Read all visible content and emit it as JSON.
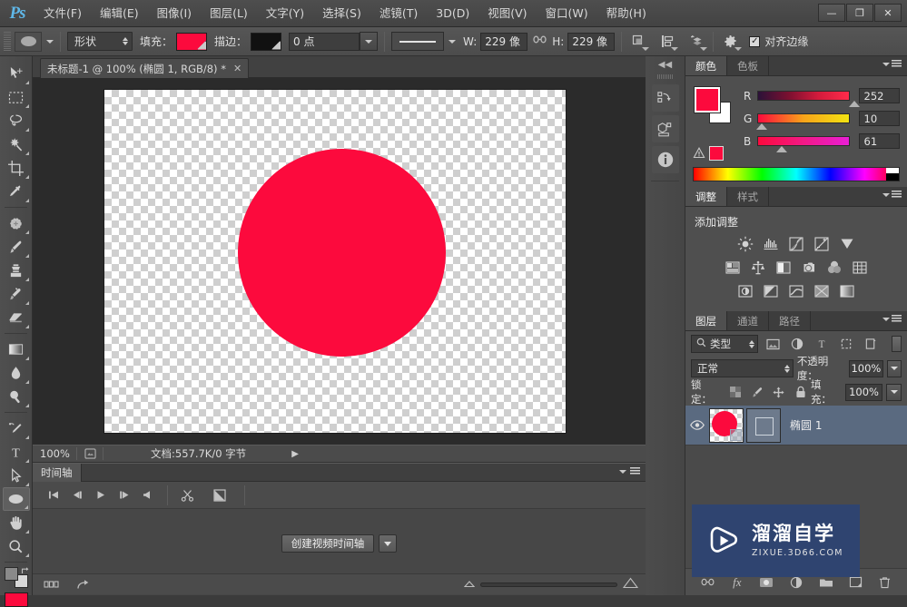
{
  "app": {
    "name": "Photoshop",
    "logo": "Ps"
  },
  "window_controls": {
    "minimize": "—",
    "maximize": "❐",
    "close": "✕"
  },
  "menubar": {
    "items": [
      {
        "label": "文件(F)"
      },
      {
        "label": "编辑(E)"
      },
      {
        "label": "图像(I)"
      },
      {
        "label": "图层(L)"
      },
      {
        "label": "文字(Y)"
      },
      {
        "label": "选择(S)"
      },
      {
        "label": "滤镜(T)"
      },
      {
        "label": "3D(D)"
      },
      {
        "label": "视图(V)"
      },
      {
        "label": "窗口(W)"
      },
      {
        "label": "帮助(H)"
      }
    ]
  },
  "options_bar": {
    "tool_icon": "ellipse-tool-icon",
    "mode_value": "形状",
    "fill_label": "填充：",
    "fill_color": "#FC0A3D",
    "stroke_label": "描边：",
    "stroke_color": "#111111",
    "stroke_width": "0 点",
    "stroke_style": "solid-line",
    "width_label": "W:",
    "width_value": "229 像",
    "link_icon": "link-icon",
    "height_label": "H:",
    "height_value": "229 像",
    "path_op_icon": "path-operations-icon",
    "path_align_icon": "path-alignment-icon",
    "path_arrange_icon": "path-arrangement-icon",
    "gear_icon": "gear-icon",
    "align_edges_checked": "✓",
    "align_edges_label": "对齐边缘"
  },
  "toolbar": {
    "tools": [
      {
        "name": "move-tool",
        "icon": "arrow-move"
      },
      {
        "name": "marquee-tool",
        "icon": "rect-marquee"
      },
      {
        "name": "lasso-tool",
        "icon": "lasso"
      },
      {
        "name": "magic-wand-tool",
        "icon": "magic-wand"
      },
      {
        "name": "crop-tool",
        "icon": "crop"
      },
      {
        "name": "eyedropper-tool",
        "icon": "eyedropper"
      },
      {
        "name": "healing-brush-tool",
        "icon": "healing"
      },
      {
        "name": "brush-tool",
        "icon": "brush"
      },
      {
        "name": "clone-stamp-tool",
        "icon": "stamp"
      },
      {
        "name": "history-brush-tool",
        "icon": "history-brush"
      },
      {
        "name": "eraser-tool",
        "icon": "eraser"
      },
      {
        "name": "gradient-tool",
        "icon": "gradient"
      },
      {
        "name": "blur-tool",
        "icon": "blur-drop"
      },
      {
        "name": "dodge-tool",
        "icon": "dodge"
      },
      {
        "name": "pen-tool",
        "icon": "pen"
      },
      {
        "name": "type-tool",
        "icon": "type-T"
      },
      {
        "name": "path-selection-tool",
        "icon": "path-arrow"
      },
      {
        "name": "ellipse-tool",
        "icon": "ellipse",
        "active": true
      },
      {
        "name": "hand-tool",
        "icon": "hand"
      },
      {
        "name": "zoom-tool",
        "icon": "magnifier"
      }
    ],
    "foreground_color": "#FC0A3D",
    "background_color": "#FFFFFF"
  },
  "document": {
    "tab_title": "未标题-1 @ 100% (椭圆 1, RGB/8) *",
    "close_label": "✕",
    "canvas": {
      "shape_color": "#FC0A3D",
      "shape_name": "ellipse-shape"
    }
  },
  "status_bar": {
    "zoom": "100%",
    "doc_icon": "document-icon",
    "doc_info": "文档:557.7K/0 字节",
    "arrow": "▶"
  },
  "timeline": {
    "tab_label": "时间轴",
    "panel_menu_icon": "panel-menu-icon",
    "controls": [
      {
        "name": "go-to-first-frame-button",
        "glyph": "|◀"
      },
      {
        "name": "previous-frame-button",
        "glyph": "◀|"
      },
      {
        "name": "play-button",
        "glyph": "▶"
      },
      {
        "name": "next-frame-button",
        "glyph": "|▶"
      },
      {
        "name": "audio-button",
        "glyph": "◀)"
      },
      {
        "name": "split-clip-button",
        "glyph": "✂"
      },
      {
        "name": "transition-button",
        "glyph": "◩"
      }
    ],
    "create_button": "创建视频时间轴",
    "create_dropdown_icon": "chevron-down-icon",
    "footer": {
      "frames_icon": "convert-to-frames-icon",
      "render_icon": "render-video-icon",
      "zoom_out_icon": "zoom-out-icon",
      "zoom_in_icon": "zoom-in-icon"
    }
  },
  "dock_strip": {
    "collapse_icon": "collapse-dock-icon",
    "icons": [
      {
        "name": "history-panel-icon"
      },
      {
        "name": "mini-bridge-panel-icon"
      },
      {
        "name": "info-panel-icon"
      }
    ]
  },
  "color_panel": {
    "tabs": [
      {
        "label": "颜色",
        "active": true
      },
      {
        "label": "色板",
        "active": false
      }
    ],
    "menu_icon": "panel-menu-icon",
    "foreground_color": "#FC0A3D",
    "background_color": "#FFFFFF",
    "channels": [
      {
        "label": "R",
        "value": "252",
        "thumb_pct": 98
      },
      {
        "label": "G",
        "value": "10",
        "thumb_pct": 4
      },
      {
        "label": "B",
        "value": "61",
        "thumb_pct": 24
      }
    ],
    "warning_icon": "out-of-gamut-warning-icon",
    "warning_swatch": "#FC0A3D"
  },
  "adjustments_panel": {
    "tabs": [
      {
        "label": "调整",
        "active": true
      },
      {
        "label": "样式",
        "active": false
      }
    ],
    "menu_icon": "panel-menu-icon",
    "title": "添加调整",
    "rows": [
      [
        {
          "name": "brightness-contrast-icon"
        },
        {
          "name": "levels-icon"
        },
        {
          "name": "curves-icon"
        },
        {
          "name": "exposure-icon"
        },
        {
          "name": "vibrance-icon"
        }
      ],
      [
        {
          "name": "hue-saturation-icon"
        },
        {
          "name": "color-balance-icon"
        },
        {
          "name": "black-white-icon"
        },
        {
          "name": "photo-filter-icon"
        },
        {
          "name": "channel-mixer-icon"
        },
        {
          "name": "color-lookup-icon"
        }
      ],
      [
        {
          "name": "invert-icon"
        },
        {
          "name": "posterize-icon"
        },
        {
          "name": "threshold-icon"
        },
        {
          "name": "selective-color-icon"
        },
        {
          "name": "gradient-map-icon"
        }
      ]
    ]
  },
  "layers_panel": {
    "tabs": [
      {
        "label": "图层",
        "active": true
      },
      {
        "label": "通道",
        "active": false
      },
      {
        "label": "路径",
        "active": false
      }
    ],
    "menu_icon": "panel-menu-icon",
    "filter": {
      "search_icon": "search-icon",
      "type_value": "类型",
      "icons": [
        {
          "name": "filter-pixel-icon"
        },
        {
          "name": "filter-adjustment-icon"
        },
        {
          "name": "filter-type-icon"
        },
        {
          "name": "filter-shape-icon"
        },
        {
          "name": "filter-smart-object-icon"
        }
      ]
    },
    "blend_mode": "正常",
    "opacity_label": "不透明度：",
    "opacity_value": "100%",
    "lock_label": "锁定：",
    "lock_icons": [
      {
        "name": "lock-transparent-pixels-icon"
      },
      {
        "name": "lock-image-pixels-icon"
      },
      {
        "name": "lock-position-icon"
      },
      {
        "name": "lock-all-icon"
      }
    ],
    "fill_label": "填充：",
    "fill_value": "100%",
    "layers": [
      {
        "name": "椭圆 1",
        "visible": true,
        "thumb_color": "#FC0A3D",
        "selected": true
      }
    ],
    "bottom_icons": [
      {
        "name": "link-layers-icon"
      },
      {
        "name": "layer-style-icon",
        "glyph": "fx"
      },
      {
        "name": "add-layer-mask-icon"
      },
      {
        "name": "new-adjustment-layer-icon"
      },
      {
        "name": "new-group-icon"
      },
      {
        "name": "new-layer-icon"
      },
      {
        "name": "delete-layer-icon"
      }
    ]
  },
  "watermark": {
    "title": "溜溜自学",
    "subtitle": "ZIXUE.3D66.COM",
    "logo_icon": "play-button-logo-icon",
    "background": "#2F4470"
  }
}
